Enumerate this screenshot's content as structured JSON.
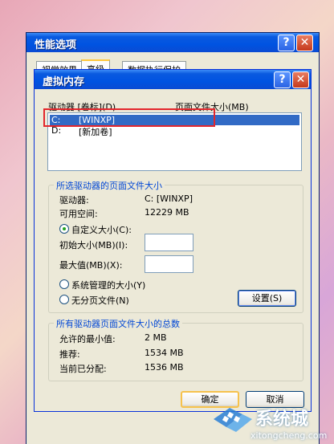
{
  "parent_window": {
    "title": "性能选项",
    "tabs": [
      "视觉效果",
      "高级",
      "数据执行保护"
    ]
  },
  "dialog": {
    "title": "虚拟内存",
    "drive_list": {
      "header_drive": "驱动器 [卷标](D)",
      "header_pagefile": "页面文件大小(MB)",
      "rows": [
        {
          "letter": "C:",
          "label": "[WINXP]",
          "selected": true
        },
        {
          "letter": "D:",
          "label": "[新加卷]",
          "selected": false
        }
      ]
    },
    "selected_drive_group": {
      "title": "所选驱动器的页面文件大小",
      "drive_label": "驱动器:",
      "drive_value": "C:  [WINXP]",
      "space_label": "可用空间:",
      "space_value": "12229 MB",
      "custom_size_label": "自定义大小(C):",
      "initial_size_label": "初始大小(MB)(I):",
      "initial_size_value": "",
      "max_size_label": "最大值(MB)(X):",
      "max_size_value": "",
      "system_managed_label": "系统管理的大小(Y)",
      "no_paging_label": "无分页文件(N)",
      "set_button": "设置(S)"
    },
    "total_group": {
      "title": "所有驱动器页面文件大小的总数",
      "min_label": "允许的最小值:",
      "min_value": "2 MB",
      "recommended_label": "推荐:",
      "recommended_value": "1534 MB",
      "current_label": "当前已分配:",
      "current_value": "1536 MB"
    },
    "ok_button": "确定",
    "cancel_button": "取消"
  },
  "watermark": {
    "brand": "系统城",
    "url": "xitongcheng.com"
  },
  "colors": {
    "titlebar": "#0053e1",
    "selection": "#316ac5",
    "group_title": "#0046d5",
    "highlight_box": "#e3262c",
    "dialog_bg": "#ece9d8"
  }
}
